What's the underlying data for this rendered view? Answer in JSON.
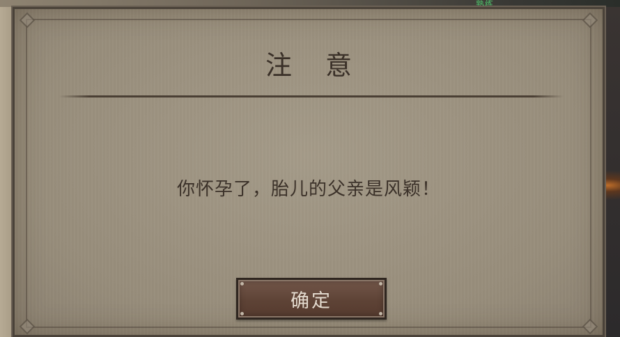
{
  "background": {
    "top_hint": "熟练"
  },
  "dialog": {
    "title": "注 意",
    "message": "你怀孕了，胎儿的父亲是风颖！",
    "confirm_label": "确定"
  },
  "colors": {
    "panel": "#9c9280",
    "title_text": "#3a3028",
    "button_bg": "#5e4336",
    "button_text": "#e4dbcf"
  }
}
